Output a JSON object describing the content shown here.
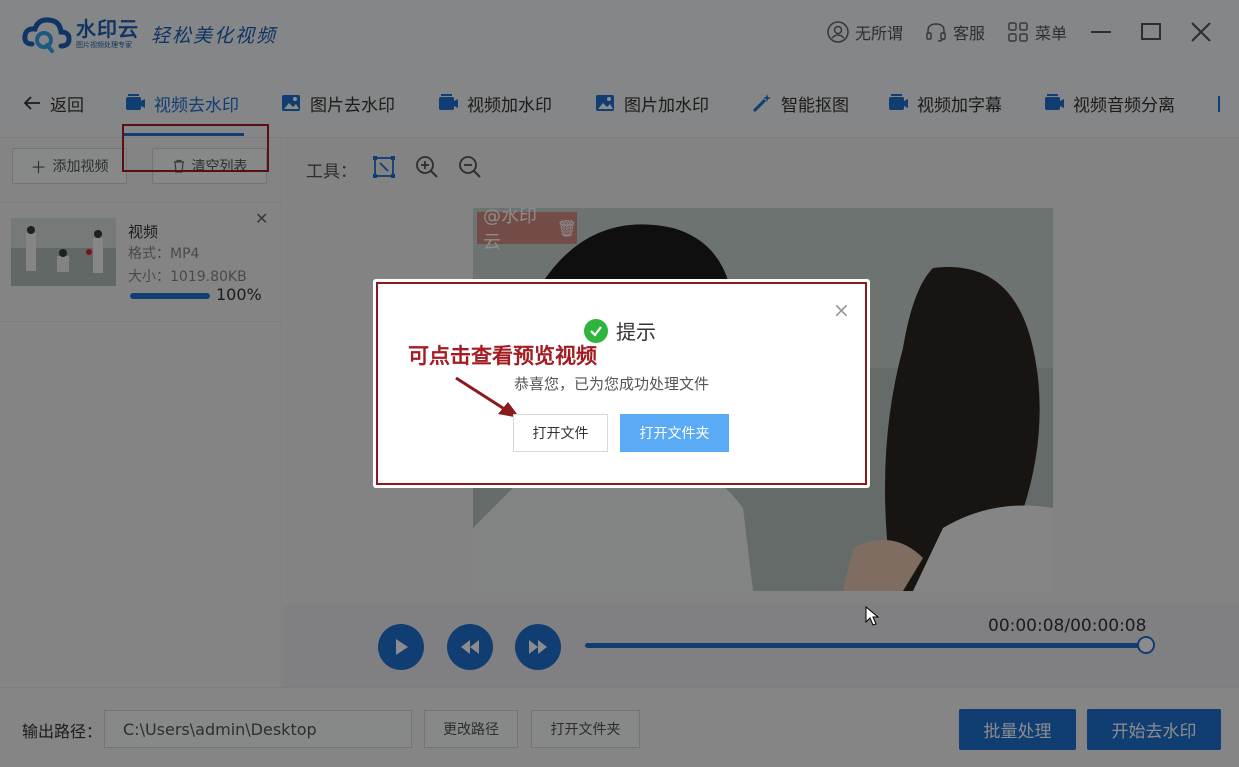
{
  "app": {
    "logo_name": "水印云",
    "logo_sub": "图片视频处理专家",
    "slogan": "轻松美化视频"
  },
  "top_actions": {
    "user": "无所谓",
    "service": "客服",
    "menu": "菜单"
  },
  "tabs": [
    {
      "label": "返回",
      "icon": "back-arrow-icon"
    },
    {
      "label": "视频去水印",
      "icon": "video-icon",
      "active": true
    },
    {
      "label": "图片去水印",
      "icon": "image-icon"
    },
    {
      "label": "视频加水印",
      "icon": "video-icon"
    },
    {
      "label": "图片加水印",
      "icon": "image-icon"
    },
    {
      "label": "智能抠图",
      "icon": "magic-wand-icon"
    },
    {
      "label": "视频加字幕",
      "icon": "video-icon"
    },
    {
      "label": "视频音频分离",
      "icon": "video-icon"
    }
  ],
  "left_panel": {
    "add_video": "添加视频",
    "clear_list": "清空列表",
    "file": {
      "name": "视频",
      "format": "格式：MP4",
      "size": "大小：1019.80KB",
      "progress_label": "100%",
      "progress": 1.0
    }
  },
  "toolbar": {
    "label": "工具："
  },
  "preview": {
    "watermark_text": "@水印云"
  },
  "player": {
    "timecode": "00:00:08/00:00:08",
    "position": 1.0
  },
  "bottom": {
    "output_label": "输出路径：",
    "output_path": "C:\\Users\\admin\\Desktop",
    "change_path": "更改路径",
    "open_folder": "打开文件夹",
    "batch": "批量处理",
    "start": "开始去水印"
  },
  "dialog": {
    "title": "提示",
    "message": "恭喜您，已为您成功处理文件",
    "open_file": "打开文件",
    "open_folder": "打开文件夹",
    "close": "×"
  },
  "annotation": {
    "text": "可点击查看预览视频"
  },
  "colors": {
    "accent": "#1e6fd0",
    "highlight": "#a41c22",
    "success": "#2fb53d",
    "secondary_button": "#5aaaf6"
  }
}
